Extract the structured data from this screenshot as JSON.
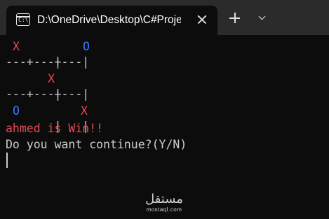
{
  "tab": {
    "title": "D:\\OneDrive\\Desktop\\C#Projects",
    "icon_text": "C:\\",
    "icon": "terminal-icon"
  },
  "buttons": {
    "close_icon": "close-icon",
    "new_tab_icon": "plus-icon",
    "dropdown_icon": "chevron-down-icon"
  },
  "board": {
    "divider": "---+---+---",
    "rows": [
      {
        "pipes": "   |   |",
        "cells": [
          "X",
          "",
          "O"
        ]
      },
      {
        "pipes": "   |   |",
        "cells": [
          "",
          "X",
          ""
        ]
      },
      {
        "pipes": "   |   |",
        "cells": [
          "O",
          "",
          "X"
        ]
      }
    ]
  },
  "output": {
    "result": "ahmed is Win!!",
    "prompt": "Do you want continue?(Y/N)"
  },
  "watermark": {
    "arabic": "مستقل",
    "latin": "mostaql.com"
  },
  "colors": {
    "x": "#e74856",
    "o": "#3b78ff",
    "text": "#cccccc",
    "background": "#0c0c0c",
    "tabbar": "#2b2b2b"
  }
}
